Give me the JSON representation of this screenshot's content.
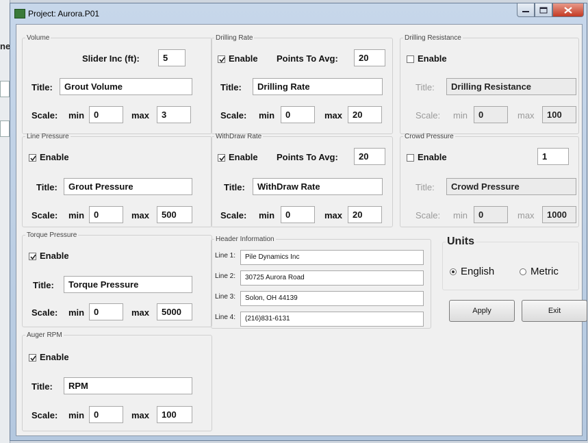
{
  "background": {
    "fragment_text": "ne"
  },
  "window": {
    "title": "Project: Aurora.P01",
    "colors": {
      "titlebar": "#b4c8df",
      "close_button": "#c43a24",
      "client": "#f0f0f0"
    }
  },
  "volume": {
    "legend": "Volume",
    "slider_label": "Slider Inc (ft):",
    "slider_value": "5",
    "title_label": "Title:",
    "title_value": "Grout Volume",
    "scale_label": "Scale:",
    "min_label": "min",
    "min_value": "0",
    "max_label": "max",
    "max_value": "3"
  },
  "drilling_rate": {
    "legend": "Drilling Rate",
    "enable_label": "Enable",
    "enabled": true,
    "points_label": "Points To Avg:",
    "points_value": "20",
    "title_label": "Title:",
    "title_value": "Drilling Rate",
    "scale_label": "Scale:",
    "min_label": "min",
    "min_value": "0",
    "max_label": "max",
    "max_value": "20"
  },
  "drilling_resistance": {
    "legend": "Drilling Resistance",
    "enable_label": "Enable",
    "enabled": false,
    "title_label": "Title:",
    "title_value": "Drilling Resistance",
    "scale_label": "Scale:",
    "min_label": "min",
    "min_value": "0",
    "max_label": "max",
    "max_value": "100"
  },
  "line_pressure": {
    "legend": "Line Pressure",
    "enable_label": "Enable",
    "enabled": true,
    "title_label": "Title:",
    "title_value": "Grout Pressure",
    "scale_label": "Scale:",
    "min_label": "min",
    "min_value": "0",
    "max_label": "max",
    "max_value": "500"
  },
  "withdraw_rate": {
    "legend": "WithDraw Rate",
    "enable_label": "Enable",
    "enabled": true,
    "points_label": "Points To Avg:",
    "points_value": "20",
    "title_label": "Title:",
    "title_value": "WithDraw Rate",
    "scale_label": "Scale:",
    "min_label": "min",
    "min_value": "0",
    "max_label": "max",
    "max_value": "20"
  },
  "crowd_pressure": {
    "legend": "Crowd Pressure",
    "enable_label": "Enable",
    "enabled": false,
    "extra_value": "1",
    "title_label": "Title:",
    "title_value": "Crowd Pressure",
    "scale_label": "Scale:",
    "min_label": "min",
    "min_value": "0",
    "max_label": "max",
    "max_value": "1000"
  },
  "torque_pressure": {
    "legend": "Torque Pressure",
    "enable_label": "Enable",
    "enabled": true,
    "title_label": "Title:",
    "title_value": "Torque Pressure",
    "scale_label": "Scale:",
    "min_label": "min",
    "min_value": "0",
    "max_label": "max",
    "max_value": "5000"
  },
  "auger_rpm": {
    "legend": "Auger RPM",
    "enable_label": "Enable",
    "enabled": true,
    "title_label": "Title:",
    "title_value": "RPM",
    "scale_label": "Scale:",
    "min_label": "min",
    "min_value": "0",
    "max_label": "max",
    "max_value": "100"
  },
  "header_info": {
    "legend": "Header Information",
    "lines": [
      {
        "label": "Line 1:",
        "value": "Pile Dynamics Inc"
      },
      {
        "label": "Line 2:",
        "value": "30725 Aurora Road"
      },
      {
        "label": "Line 3:",
        "value": "Solon, OH 44139"
      },
      {
        "label": "Line 4:",
        "value": "(216)831-6131"
      }
    ]
  },
  "units": {
    "legend": "Units",
    "options": [
      "English",
      "Metric"
    ],
    "selected": "English"
  },
  "buttons": {
    "apply": "Apply",
    "exit": "Exit"
  }
}
